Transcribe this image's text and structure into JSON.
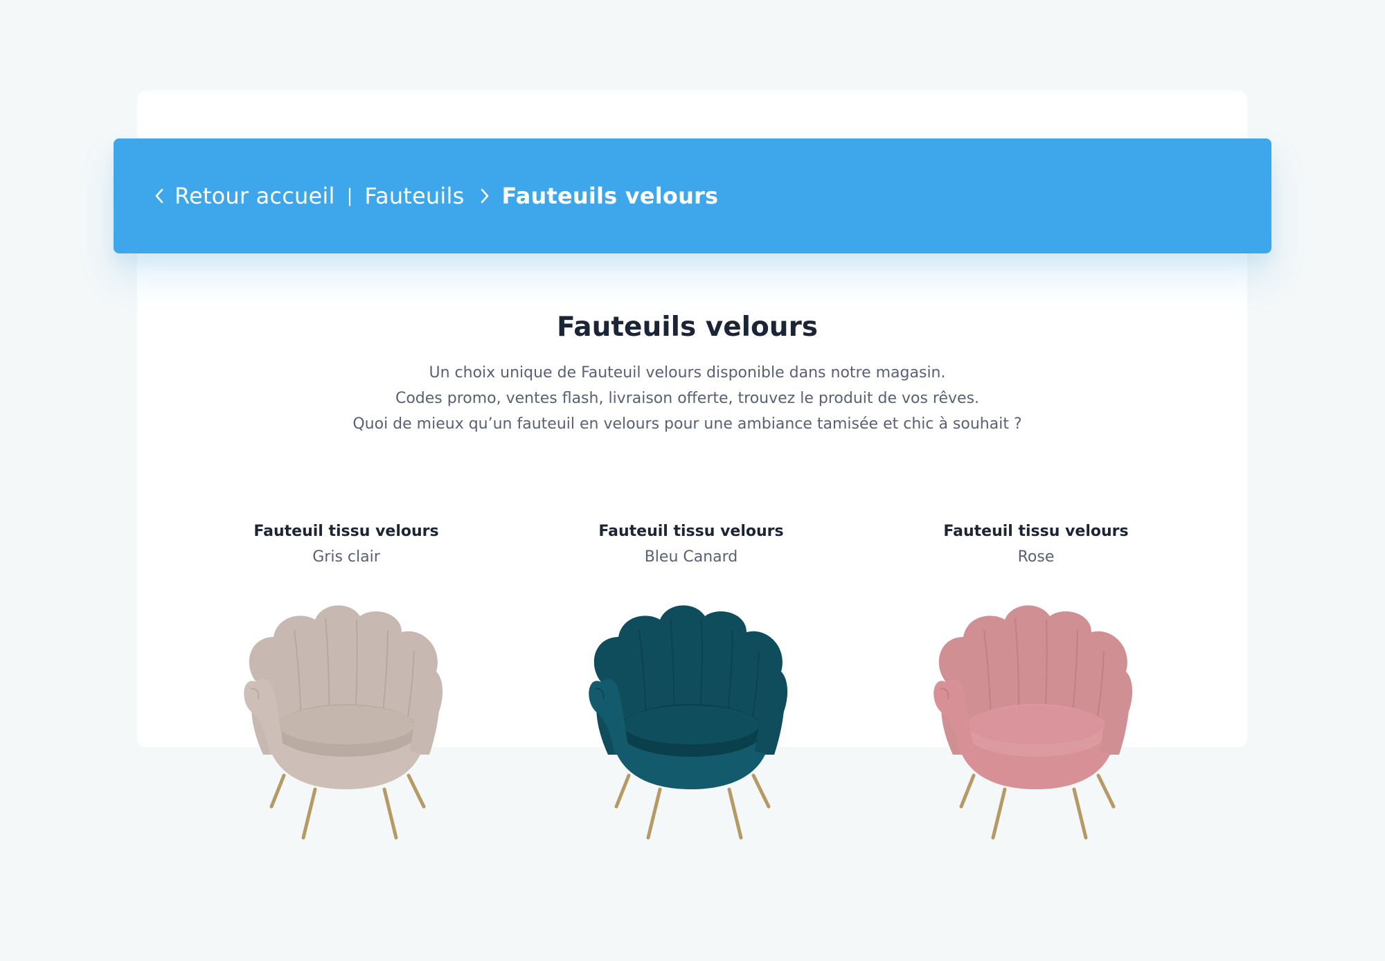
{
  "breadcrumb": {
    "back_label": "Retour accueil",
    "separator": "|",
    "parent_label": "Fauteuils",
    "current_label": "Fauteuils velours"
  },
  "header": {
    "title": "Fauteuils velours",
    "description_lines": [
      "Un choix unique de Fauteuil velours disponible dans notre magasin.",
      "Codes promo, ventes flash, livraison offerte, trouvez le produit de vos rêves.",
      "Quoi de mieux qu’un fauteuil en velours pour une ambiance tamisée et chic à souhait ?"
    ]
  },
  "products": [
    {
      "name": "Fauteuil tissu velours",
      "color": "Gris clair",
      "swatch": {
        "back": "#c7b9b1",
        "seat": "#b9aba2",
        "front": "#cdbfb7",
        "line": "#a89991"
      }
    },
    {
      "name": "Fauteuil tissu velours",
      "color": "Bleu Canard",
      "swatch": {
        "back": "#0f4d5c",
        "seat": "#0a3f4c",
        "front": "#135b6c",
        "line": "#0a3a46"
      }
    },
    {
      "name": "Fauteuil tissu velours",
      "color": "Rose",
      "swatch": {
        "back": "#cf8f93",
        "seat": "#dc9aa1",
        "front": "#d89097",
        "line": "#b5757b"
      }
    }
  ],
  "colors": {
    "accent": "#3ea6ea",
    "title": "#1c2536",
    "body_text": "#586076",
    "background": "#f4f8f9",
    "chair_legs": "#b59a63"
  }
}
